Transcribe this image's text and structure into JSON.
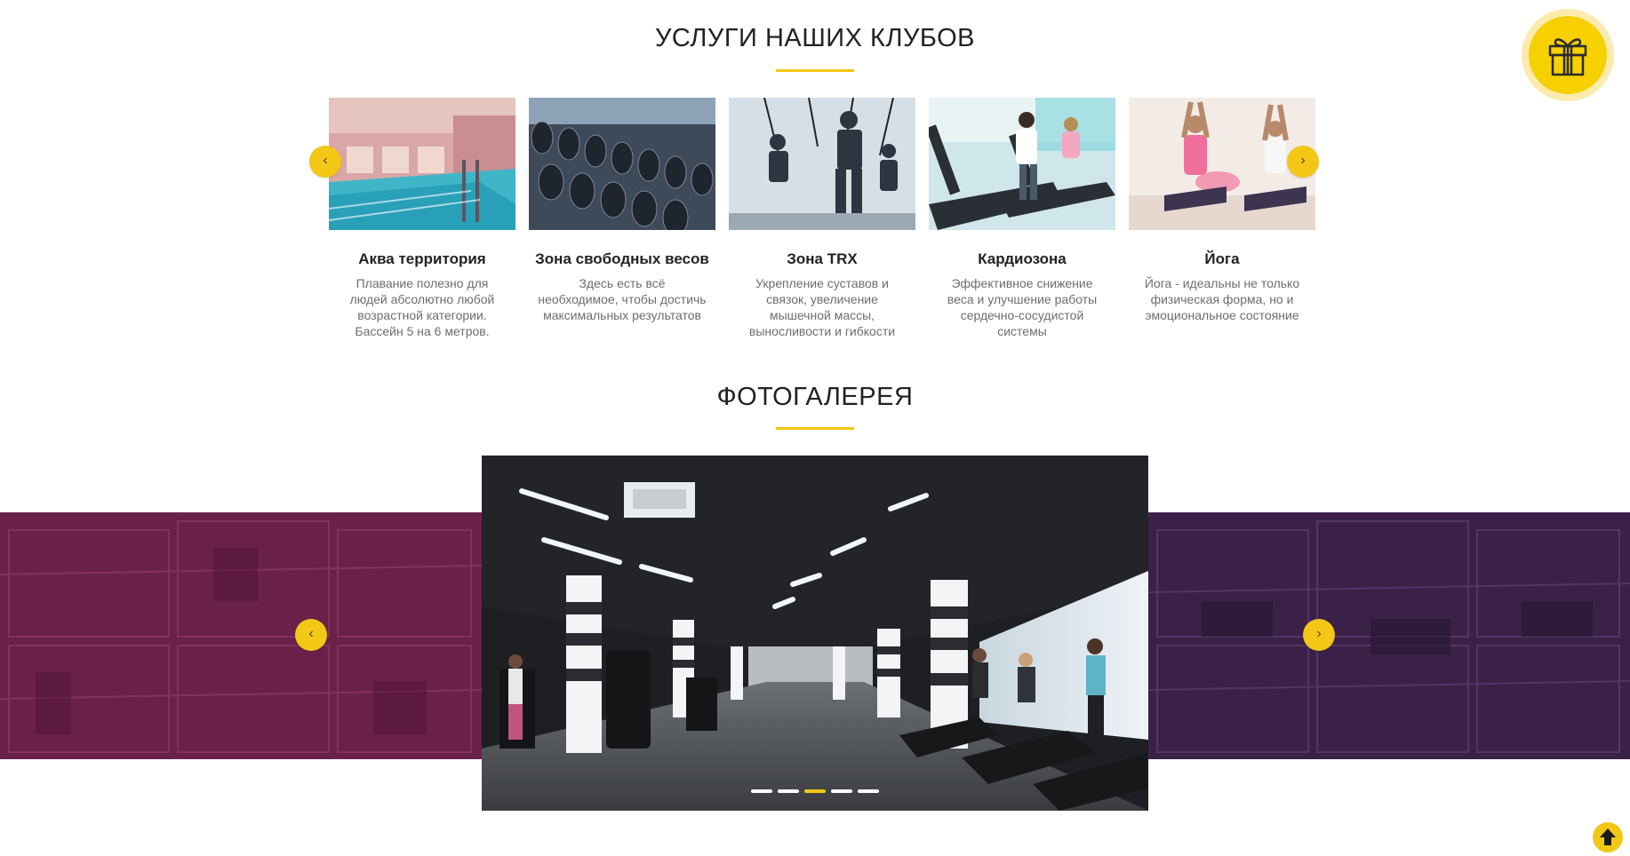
{
  "services_section": {
    "title": "УСЛУГИ НАШИХ КЛУБОВ",
    "prev_icon": "‹",
    "next_icon": "›",
    "items": [
      {
        "name": "Аква территория",
        "description": "Плавание полезно для людей абсолютно любой возрастной категории. Бассейн 5 на 6 метров.",
        "photo": "pool-photo"
      },
      {
        "name": "Зона свободных весов",
        "description": "Здесь есть всё необходимое, чтобы достичь максимальных результатов",
        "photo": "dumbbells-photo"
      },
      {
        "name": "Зона TRX",
        "description": "Укрепление суставов и связок, увеличение мышечной массы, выносливости и гибкости",
        "photo": "trx-photo"
      },
      {
        "name": "Кардиозона",
        "description": "Эффективное снижение веса и улучшение работы сердечно-сосудистой системы",
        "photo": "treadmill-photo"
      },
      {
        "name": "Йога",
        "description": "Йога - идеальны не только физическая форма, но и эмоциональное состояние",
        "photo": "yoga-photo"
      }
    ]
  },
  "gallery_section": {
    "title": "ФОТОГАЛЕРЕЯ",
    "prev_icon": "‹",
    "next_icon": "›",
    "slide_count": 5,
    "active_slide": 3
  },
  "widgets": {
    "gift_icon": "gift-icon",
    "scroll_top_icon": "arrow-up-icon"
  },
  "colors": {
    "accent": "#f3c716",
    "band_left": "#6a2149",
    "band_right": "#3b2148"
  }
}
